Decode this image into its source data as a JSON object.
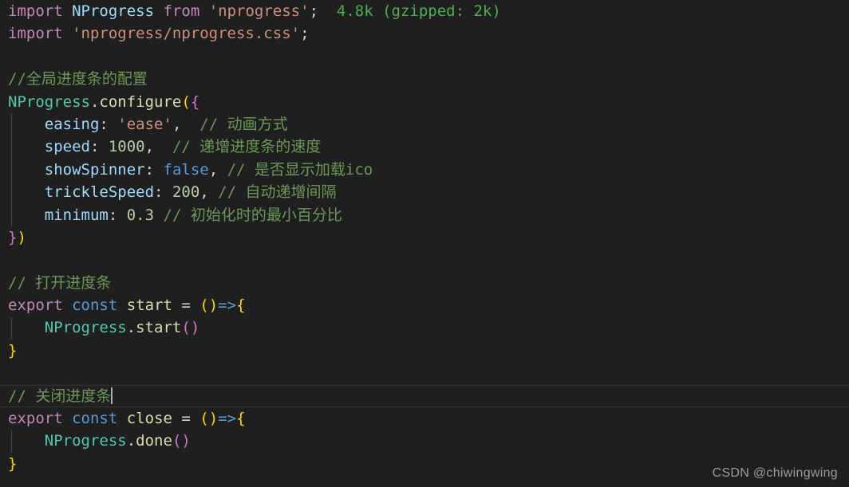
{
  "editor": {
    "background": "#1f1f1f",
    "default_text_color": "#d4d4d4",
    "language": "javascript",
    "current_line_number": 18,
    "cursor_after_text": "// 关闭进度条"
  },
  "palette": {
    "keyword_import_export": "#c586c0",
    "keyword_const_false": "#569cd6",
    "identifier": "#9cdcfe",
    "class_object": "#4ec9b0",
    "function": "#dcdcaa",
    "string": "#ce9178",
    "number": "#b5cea8",
    "comment": "#6a9955",
    "bracket_level_1": "#ffd700",
    "bracket_level_2": "#da70d6",
    "bracket_level_3": "#179fff",
    "inline_hint": "#4cb04c",
    "cursor": "#aeaeae",
    "indent_guide": "#474747",
    "current_line_border": "#343434"
  },
  "lines": [
    {
      "n": 1,
      "tokens": [
        {
          "t": "import",
          "c": "kw"
        },
        {
          "t": " ",
          "c": "op"
        },
        {
          "t": "NProgress",
          "c": "var"
        },
        {
          "t": " ",
          "c": "op"
        },
        {
          "t": "from",
          "c": "kw"
        },
        {
          "t": " ",
          "c": "op"
        },
        {
          "t": "'nprogress'",
          "c": "str"
        },
        {
          "t": ";",
          "c": "op"
        },
        {
          "t": "  4.8k (gzipped: 2k)",
          "c": "hint"
        }
      ]
    },
    {
      "n": 2,
      "tokens": [
        {
          "t": "import",
          "c": "kw"
        },
        {
          "t": " ",
          "c": "op"
        },
        {
          "t": "'nprogress/nprogress.css'",
          "c": "str"
        },
        {
          "t": ";",
          "c": "op"
        }
      ]
    },
    {
      "n": 3,
      "tokens": []
    },
    {
      "n": 4,
      "tokens": [
        {
          "t": "//全局进度条的配置",
          "c": "cmt"
        }
      ]
    },
    {
      "n": 5,
      "tokens": [
        {
          "t": "NProgress",
          "c": "cls"
        },
        {
          "t": ".",
          "c": "op"
        },
        {
          "t": "configure",
          "c": "fn"
        },
        {
          "t": "(",
          "c": "p1"
        },
        {
          "t": "{",
          "c": "p2"
        }
      ]
    },
    {
      "n": 6,
      "tokens": [
        {
          "t": "    ",
          "c": "op"
        },
        {
          "t": "easing",
          "c": "var"
        },
        {
          "t": ": ",
          "c": "op"
        },
        {
          "t": "'ease'",
          "c": "str"
        },
        {
          "t": ",",
          "c": "op"
        },
        {
          "t": "  // 动画方式",
          "c": "cmt"
        }
      ]
    },
    {
      "n": 7,
      "tokens": [
        {
          "t": "    ",
          "c": "op"
        },
        {
          "t": "speed",
          "c": "var"
        },
        {
          "t": ": ",
          "c": "op"
        },
        {
          "t": "1000",
          "c": "num"
        },
        {
          "t": ",",
          "c": "op"
        },
        {
          "t": "  // 递增进度条的速度",
          "c": "cmt"
        }
      ]
    },
    {
      "n": 8,
      "tokens": [
        {
          "t": "    ",
          "c": "op"
        },
        {
          "t": "showSpinner",
          "c": "var"
        },
        {
          "t": ": ",
          "c": "op"
        },
        {
          "t": "false",
          "c": "kw2"
        },
        {
          "t": ",",
          "c": "op"
        },
        {
          "t": " // 是否显示加载ico",
          "c": "cmt"
        }
      ]
    },
    {
      "n": 9,
      "tokens": [
        {
          "t": "    ",
          "c": "op"
        },
        {
          "t": "trickleSpeed",
          "c": "var"
        },
        {
          "t": ": ",
          "c": "op"
        },
        {
          "t": "200",
          "c": "num"
        },
        {
          "t": ",",
          "c": "op"
        },
        {
          "t": " // 自动递增间隔",
          "c": "cmt"
        }
      ]
    },
    {
      "n": 10,
      "tokens": [
        {
          "t": "    ",
          "c": "op"
        },
        {
          "t": "minimum",
          "c": "var"
        },
        {
          "t": ": ",
          "c": "op"
        },
        {
          "t": "0.3",
          "c": "num"
        },
        {
          "t": " // 初始化时的最小百分比",
          "c": "cmt"
        }
      ]
    },
    {
      "n": 11,
      "tokens": [
        {
          "t": "}",
          "c": "p2"
        },
        {
          "t": ")",
          "c": "p1"
        }
      ]
    },
    {
      "n": 12,
      "tokens": []
    },
    {
      "n": 13,
      "tokens": [
        {
          "t": "// 打开进度条",
          "c": "cmt"
        }
      ]
    },
    {
      "n": 14,
      "tokens": [
        {
          "t": "export",
          "c": "kw"
        },
        {
          "t": " ",
          "c": "op"
        },
        {
          "t": "const",
          "c": "kw2"
        },
        {
          "t": " ",
          "c": "op"
        },
        {
          "t": "start",
          "c": "fn"
        },
        {
          "t": " = ",
          "c": "op"
        },
        {
          "t": "()",
          "c": "p1"
        },
        {
          "t": "=>",
          "c": "kw2"
        },
        {
          "t": "{",
          "c": "p1"
        }
      ]
    },
    {
      "n": 15,
      "tokens": [
        {
          "t": "    ",
          "c": "op"
        },
        {
          "t": "NProgress",
          "c": "cls"
        },
        {
          "t": ".",
          "c": "op"
        },
        {
          "t": "start",
          "c": "fn"
        },
        {
          "t": "()",
          "c": "p2"
        }
      ]
    },
    {
      "n": 16,
      "tokens": [
        {
          "t": "}",
          "c": "p1"
        }
      ]
    },
    {
      "n": 17,
      "tokens": []
    },
    {
      "n": 18,
      "current": true,
      "tokens": [
        {
          "t": "// 关闭进度条",
          "c": "cmt"
        }
      ]
    },
    {
      "n": 19,
      "tokens": [
        {
          "t": "export",
          "c": "kw"
        },
        {
          "t": " ",
          "c": "op"
        },
        {
          "t": "const",
          "c": "kw2"
        },
        {
          "t": " ",
          "c": "op"
        },
        {
          "t": "close",
          "c": "fn"
        },
        {
          "t": " = ",
          "c": "op"
        },
        {
          "t": "()",
          "c": "p1"
        },
        {
          "t": "=>",
          "c": "kw2"
        },
        {
          "t": "{",
          "c": "p1"
        }
      ]
    },
    {
      "n": 20,
      "tokens": [
        {
          "t": "    ",
          "c": "op"
        },
        {
          "t": "NProgress",
          "c": "cls"
        },
        {
          "t": ".",
          "c": "op"
        },
        {
          "t": "done",
          "c": "fn"
        },
        {
          "t": "()",
          "c": "p2"
        }
      ]
    },
    {
      "n": 21,
      "tokens": [
        {
          "t": "}",
          "c": "p1"
        }
      ]
    }
  ],
  "indent_guides": [
    {
      "from_line": 6,
      "to_line": 10
    },
    {
      "from_line": 15,
      "to_line": 15
    },
    {
      "from_line": 20,
      "to_line": 20
    }
  ],
  "watermark": {
    "text": "CSDN @chiwingwing"
  }
}
